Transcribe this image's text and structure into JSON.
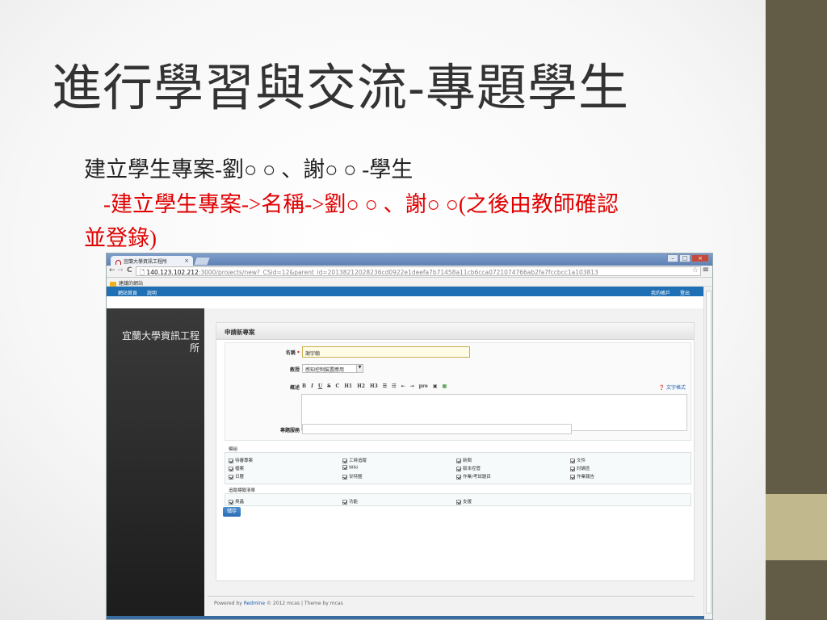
{
  "slide": {
    "title": "進行學習與交流-專題學生",
    "bullet1": "建立學生專案-劉○ ○ 、謝○ ○ -學生",
    "bullet2_line1": "-建立學生專案->名稱->劉○ ○ 、謝○ ○(之後由教師確認",
    "bullet2_line2": "並登錄)"
  },
  "browser": {
    "tab_title": "宜蘭大學資訊工程所",
    "tab_close": "×",
    "window_buttons": [
      "–",
      "□",
      "×"
    ],
    "nav": {
      "back": "←",
      "forward": "→",
      "reload": "C",
      "page": "🗋"
    },
    "url_host": "140.123.102.212",
    "url_rest": ":3000/projects/new?_CSid=12&parent_id=20138212028236cd0922e1deefa7b71458a11cb6cca0721074766ab2fa7fccbcc1a103813",
    "star": "☆",
    "menu": "≡",
    "bookmark_label": "建議的網站"
  },
  "redmine": {
    "top_menu_left": [
      "網站首頁",
      "說明"
    ],
    "top_menu_right": [
      "我的帳戶",
      "登出"
    ],
    "site_name": "宜蘭大學資訊工程所",
    "page_heading": "申請新專案",
    "form": {
      "name_label": "名稱",
      "name_required": "*",
      "name_value": "謝宇翰",
      "teacher_label": "教授",
      "teacher_value": "感知控制裝置應用",
      "desc_label": "概述",
      "toolbar_buttons": [
        "B",
        "I",
        "U",
        "S",
        "C",
        "H1",
        "H2",
        "H3",
        "☰",
        "☷",
        "⇤",
        "⇥",
        "pre",
        "▣",
        "▦"
      ],
      "text_format_link": "文字格式",
      "homepage_label": "專題服務"
    },
    "modules": {
      "legend": "模組",
      "items": [
        "待審專案",
        "工時追蹤",
        "新聞",
        "文件",
        "檔案",
        "Wiki",
        "版本控管",
        "討論區",
        "日曆",
        "甘特圖",
        "作業/考試題目",
        "作業報告"
      ]
    },
    "trackers": {
      "legend": "追蹤標籤清單",
      "items": [
        "臭蟲",
        "功能",
        "支援"
      ]
    },
    "save_label": "儲存",
    "footer_prefix": "Powered by ",
    "footer_link": "Redmine",
    "footer_suffix": " © 2012 mcas | Theme by mcas"
  },
  "colors": {
    "accent_red": "#e00000",
    "deco_dark": "#625b46",
    "deco_light": "#c2b88e",
    "redmine_blue": "#1f6fb5"
  }
}
